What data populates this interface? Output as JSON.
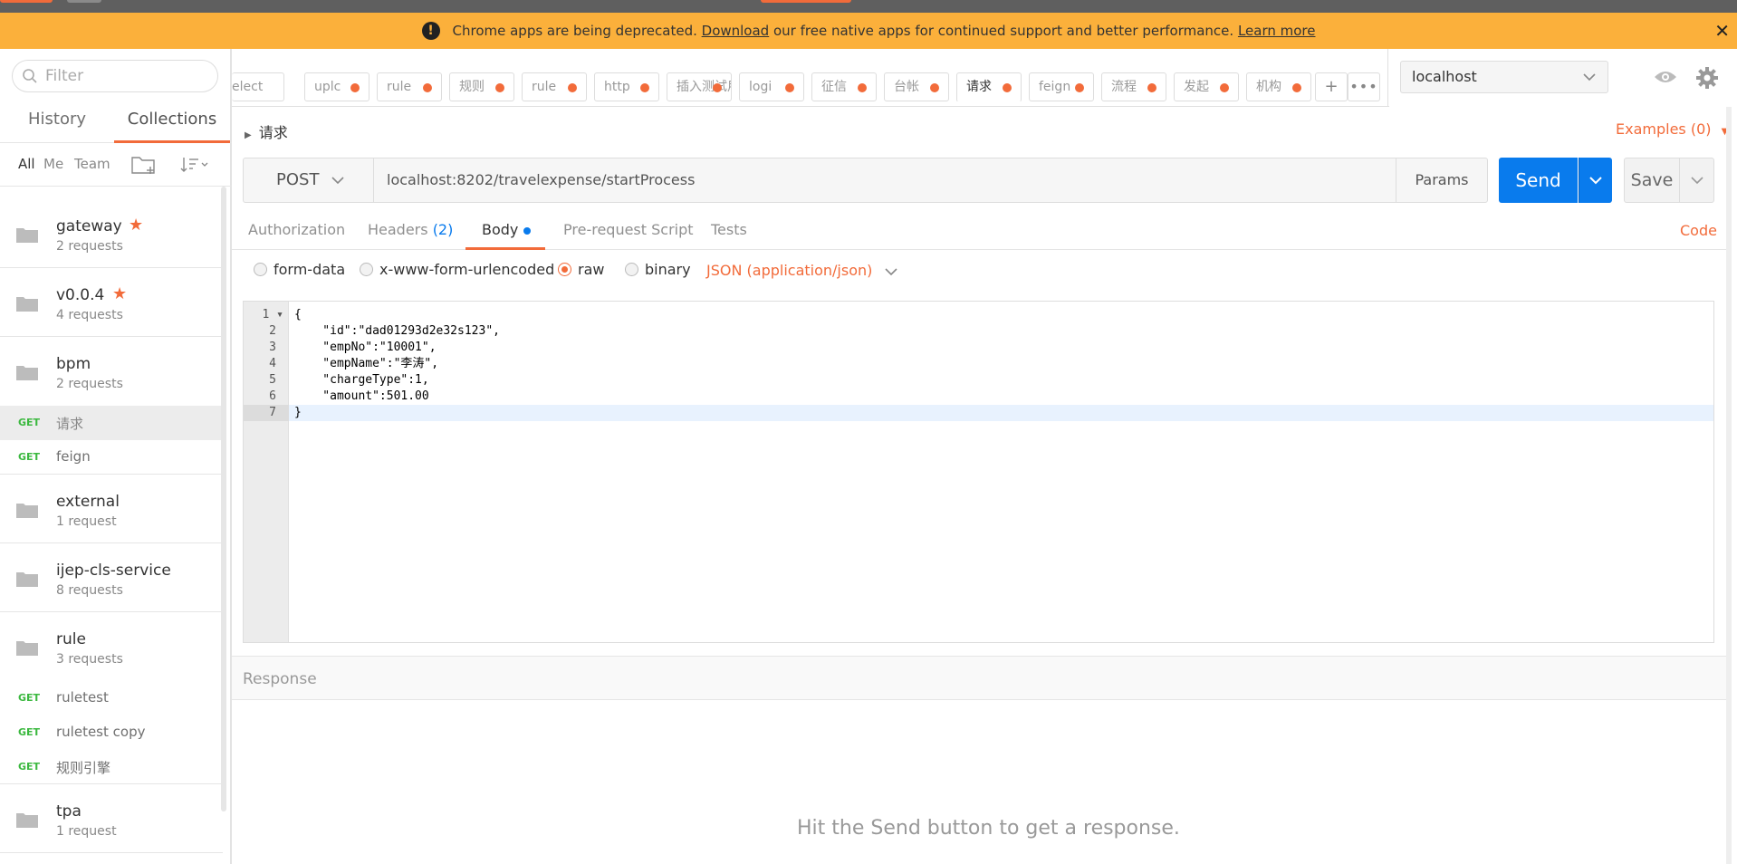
{
  "banner": {
    "prefix": "Chrome apps are being deprecated.",
    "download": "Download",
    "middle": "our free native apps for continued support and better performance.",
    "learn_more": "Learn more",
    "color": "#fbb03b"
  },
  "sidebar": {
    "filter_placeholder": "Filter",
    "tabs": {
      "history": "History",
      "collections": "Collections"
    },
    "filters": {
      "all": "All",
      "me": "Me",
      "team": "Team"
    },
    "collections": [
      {
        "name": "gateway",
        "count": "2 requests",
        "starred": true
      },
      {
        "name": "v0.0.4",
        "count": "4 requests",
        "starred": true
      },
      {
        "name": "bpm",
        "count": "2 requests",
        "requests": [
          {
            "method": "GET",
            "name": "请求"
          },
          {
            "method": "GET",
            "name": "feign"
          }
        ]
      },
      {
        "name": "external",
        "count": "1 request"
      },
      {
        "name": "ijep-cls-service",
        "count": "8 requests"
      },
      {
        "name": "rule",
        "count": "3 requests",
        "requests": [
          {
            "method": "GET",
            "name": "ruletest"
          },
          {
            "method": "GET",
            "name": "ruletest copy"
          },
          {
            "method": "GET",
            "name": "规则引擎"
          }
        ]
      },
      {
        "name": "tpa",
        "count": "1 request"
      }
    ]
  },
  "tabs": [
    "elect",
    "uplc",
    "rule",
    "规则",
    "rule",
    "http",
    "插入测试用",
    "logi",
    "征信",
    "台帐",
    "请求",
    "feign",
    "流程",
    "发起",
    "机构"
  ],
  "active_tab": "请求",
  "environment": "localhost",
  "request": {
    "title": "请求",
    "examples": "Examples (0)",
    "method": "POST",
    "url": "localhost:8202/travelexpense/startProcess",
    "params": "Params",
    "send": "Send",
    "save": "Save",
    "subtabs": {
      "authorization": "Authorization",
      "headers": "Headers",
      "headers_count": "(2)",
      "body": "Body",
      "prerequest": "Pre-request Script",
      "tests": "Tests",
      "code": "Code"
    },
    "body_types": {
      "form_data": "form-data",
      "urlencoded": "x-www-form-urlencoded",
      "raw": "raw",
      "binary": "binary",
      "json": "JSON (application/json)"
    },
    "body_lines": [
      "{",
      "    \"id\":\"dad01293d2e32s123\",",
      "    \"empNo\":\"10001\",",
      "    \"empName\":\"李涛\",",
      "    \"chargeType\":1,",
      "    \"amount\":501.00",
      "}"
    ]
  },
  "response": {
    "title": "Response",
    "empty": "Hit the Send button to get a response."
  },
  "colors": {
    "accent": "#f26b3a",
    "primary": "#097bed",
    "get": "#3bb83f"
  }
}
